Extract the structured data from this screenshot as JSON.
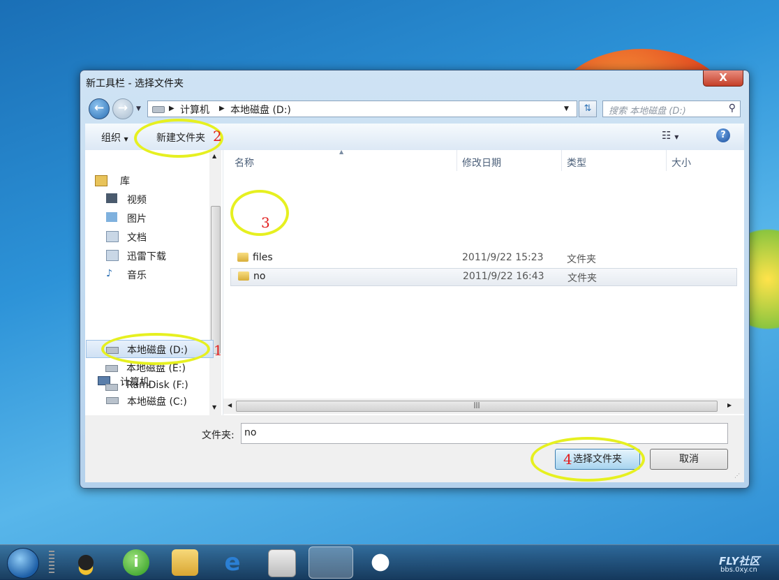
{
  "window": {
    "title": "新工具栏 - 选择文件夹",
    "close_label": "X"
  },
  "address": {
    "crumbs": [
      "计算机",
      "本地磁盘 (D:)"
    ],
    "search_placeholder": "搜索 本地磁盘 (D:)"
  },
  "toolbar": {
    "organize": "组织",
    "new_folder": "新建文件夹"
  },
  "sidebar": {
    "libraries": "库",
    "lib_items": [
      "视频",
      "图片",
      "文档",
      "迅雷下载",
      "音乐"
    ],
    "computer": "计算机",
    "drives": [
      "本地磁盘 (C:)",
      "本地磁盘 (D:)",
      "本地磁盘 (E:)",
      "RamDisk (F:)"
    ]
  },
  "columns": [
    "名称",
    "修改日期",
    "类型",
    "大小"
  ],
  "files": [
    {
      "name": "files",
      "date": "2011/9/22 15:23",
      "type": "文件夹"
    },
    {
      "name": "no",
      "date": "2011/9/22 16:43",
      "type": "文件夹"
    }
  ],
  "folder_field": {
    "label": "文件夹:",
    "value": "no"
  },
  "buttons": {
    "select": "选择文件夹",
    "cancel": "取消"
  },
  "annotations": {
    "n1": "1",
    "n2": "2",
    "n3": "3",
    "n4": "4"
  },
  "watermark": {
    "brand": "FLY社区",
    "url": "bbs.0xy.cn"
  },
  "colors": {
    "highlight": "#e6f020",
    "annotation_number": "#e21d1d"
  }
}
